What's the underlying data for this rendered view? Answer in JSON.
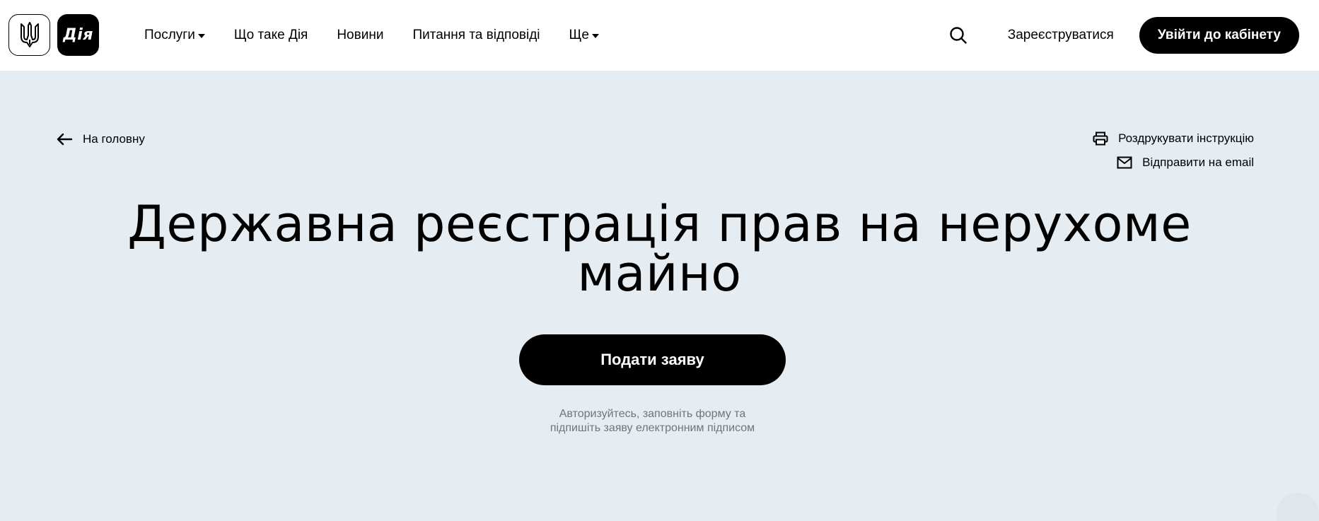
{
  "header": {
    "logo_text": "Дія",
    "nav": [
      {
        "label": "Послуги",
        "has_dropdown": true
      },
      {
        "label": "Що таке Дія",
        "has_dropdown": false
      },
      {
        "label": "Новини",
        "has_dropdown": false
      },
      {
        "label": "Питання та відповіді",
        "has_dropdown": false
      },
      {
        "label": "Ще",
        "has_dropdown": true
      }
    ],
    "register_label": "Зареєструватися",
    "login_label": "Увійти до кабінету",
    "icons": {
      "search": "search-icon",
      "trident": "trident-icon",
      "dropdown": "chevron-down-icon"
    }
  },
  "content": {
    "back_label": "На головну",
    "print_label": "Роздрукувати інструкцію",
    "email_label": "Відправити на email",
    "title_line1": "Державна реєстрація прав на нерухоме",
    "title_line2": "майно",
    "submit_label": "Подати заяву",
    "hint_line1": "Авторизуйтесь, заповніть форму та",
    "hint_line2": "підпишіть заяву електронним підписом",
    "icons": {
      "back": "arrow-left-icon",
      "print": "printer-icon",
      "email": "mail-icon"
    }
  },
  "colors": {
    "background": "#e5ecf2",
    "header": "#ffffff",
    "primary": "#000000",
    "muted_text": "#6f757c"
  }
}
